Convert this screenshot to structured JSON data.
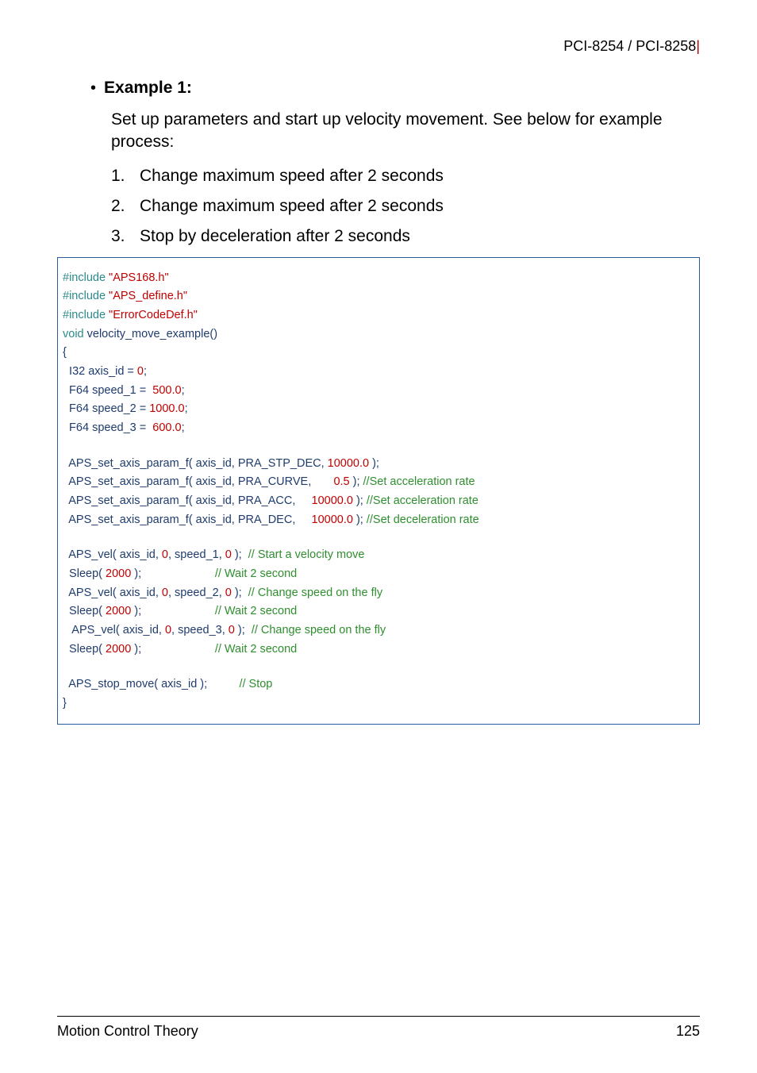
{
  "header": {
    "product_a": "PCI-8254",
    "sep": " / ",
    "product_b": "PCI-8258",
    "bar": "|"
  },
  "bullet": {
    "dot": "•",
    "title": "Example 1:"
  },
  "intro": "Set up parameters and start up velocity movement. See below for example process:",
  "steps": [
    {
      "n": "1.",
      "t": "Change maximum speed after 2 seconds"
    },
    {
      "n": "2.",
      "t": "Change maximum speed after 2 seconds"
    },
    {
      "n": "3.",
      "t": "Stop by deceleration after 2 seconds"
    }
  ],
  "code": {
    "l01a": "#include",
    "l01b": " \"APS168.h\"",
    "l02a": "#include",
    "l02b": " \"APS_define.h\"",
    "l03a": "#include",
    "l03b": " \"ErrorCodeDef.h\"",
    "l04a": "void",
    "l04b": " velocity_move_example()",
    "l05": "{",
    "l06a": "  I32 axis_id = ",
    "l06b": "0",
    "l06c": ";",
    "l07a": "  F64 speed_1 =  ",
    "l07b": "500.0",
    "l07c": ";",
    "l08a": "  F64 speed_2 = ",
    "l08b": "1000.0",
    "l08c": ";",
    "l09a": "  F64 speed_3 =  ",
    "l09b": "600.0",
    "l09c": ";",
    "l11a": "  APS_set_axis_param_f( axis_id, PRA_STP_DEC, ",
    "l11b": "10000.0",
    "l11c": " );",
    "l12a": "  APS_set_axis_param_f( axis_id, PRA_CURVE,       ",
    "l12b": "0.5",
    "l12c": " ); ",
    "l12d": "//Set acceleration rate",
    "l13a": "  APS_set_axis_param_f( axis_id, PRA_ACC,     ",
    "l13b": "10000.0",
    "l13c": " ); ",
    "l13d": "//Set acceleration rate",
    "l14a": "  APS_set_axis_param_f( axis_id, PRA_DEC,     ",
    "l14b": "10000.0",
    "l14c": " ); ",
    "l14d": "//Set deceleration rate",
    "l16a": "  APS_vel( axis_id, ",
    "l16b": "0",
    "l16c": ", speed_1, ",
    "l16d": "0",
    "l16e": " );  ",
    "l16f": "// Start a velocity move",
    "l17a": "  Sleep( ",
    "l17b": "2000",
    "l17c": " );                       ",
    "l17d": "// Wait 2 second",
    "l18a": "  APS_vel( axis_id, ",
    "l18b": "0",
    "l18c": ", speed_2, ",
    "l18d": "0",
    "l18e": " );  ",
    "l18f": "// Change speed on the fly",
    "l19a": "  Sleep( ",
    "l19b": "2000",
    "l19c": " );                       ",
    "l19d": "// Wait 2 second",
    "l20a": "   APS_vel( axis_id, ",
    "l20b": "0",
    "l20c": ", speed_3, ",
    "l20d": "0",
    "l20e": " );  ",
    "l20f": "// Change speed on the fly",
    "l21a": "  Sleep( ",
    "l21b": "2000",
    "l21c": " );                       ",
    "l21d": "// Wait 2 second",
    "l23a": "  APS_stop_move( axis_id );          ",
    "l23b": "// Stop",
    "l24": "}"
  },
  "footer": {
    "left": "Motion Control Theory",
    "right": "125"
  }
}
